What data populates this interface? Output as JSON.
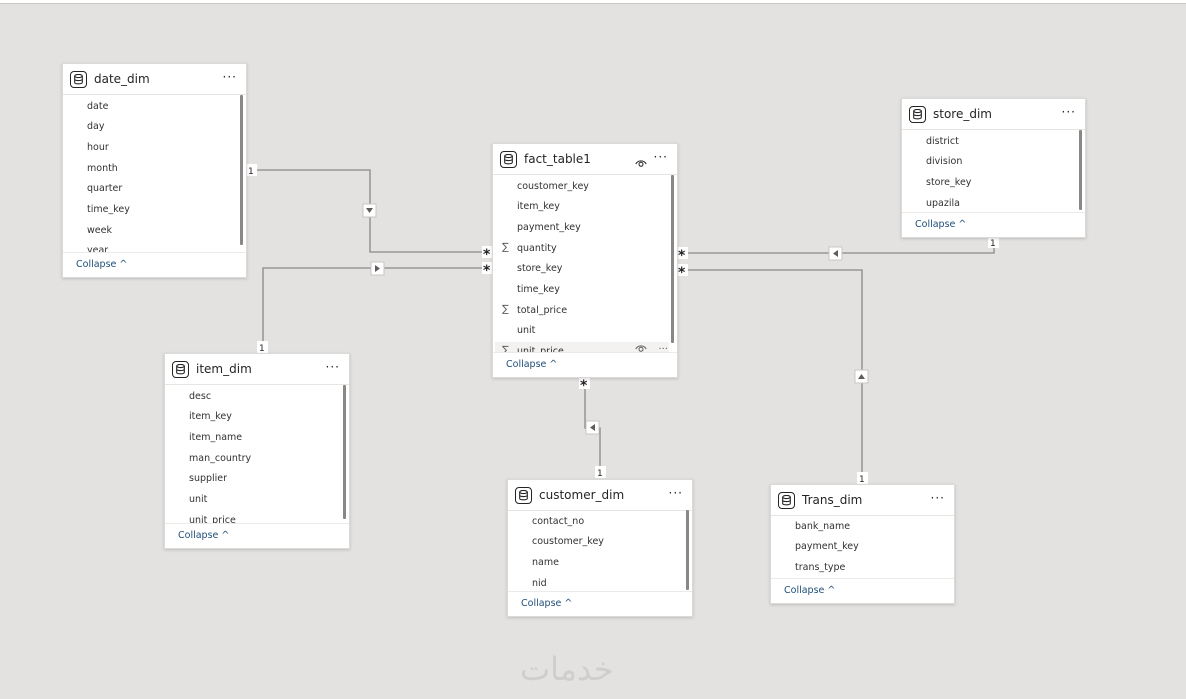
{
  "tables": {
    "date_dim": {
      "title": "date_dim",
      "more": "···",
      "fields": [
        "date",
        "day",
        "hour",
        "month",
        "quarter",
        "time_key",
        "week",
        "year"
      ],
      "collapse": "Collapse ^"
    },
    "fact_table1": {
      "title": "fact_table1",
      "more": "···",
      "fields": [
        "coustomer_key",
        "item_key",
        "payment_key",
        "quantity",
        "store_key",
        "time_key",
        "total_price",
        "unit",
        "unit_price"
      ],
      "collapse": "Collapse ^"
    },
    "store_dim": {
      "title": "store_dim",
      "more": "···",
      "fields": [
        "district",
        "division",
        "store_key",
        "upazila"
      ],
      "collapse": "Collapse ^"
    },
    "item_dim": {
      "title": "item_dim",
      "more": "···",
      "fields": [
        "desc",
        "item_key",
        "item_name",
        "man_country",
        "supplier",
        "unit",
        "unit_price"
      ],
      "collapse": "Collapse ^"
    },
    "customer_dim": {
      "title": "customer_dim",
      "more": "···",
      "fields": [
        "contact_no",
        "coustomer_key",
        "name",
        "nid"
      ],
      "collapse": "Collapse ^"
    },
    "trans_dim": {
      "title": "Trans_dim",
      "more": "···",
      "fields": [
        "bank_name",
        "payment_key",
        "trans_type"
      ],
      "collapse": "Collapse ^"
    }
  },
  "cardinality": {
    "one": "1",
    "many": "*"
  },
  "watermark": "خدمات"
}
